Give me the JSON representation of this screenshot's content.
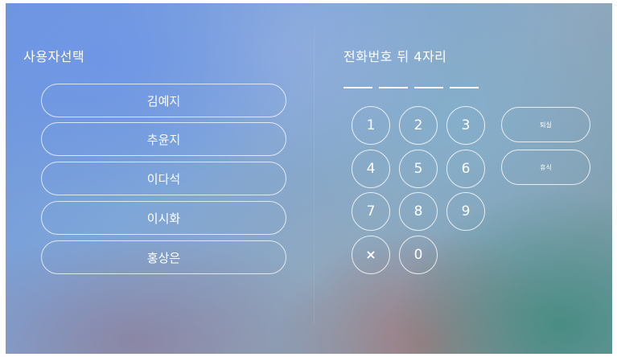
{
  "left_panel": {
    "heading": "사용자선택",
    "users": [
      "김예지",
      "추윤지",
      "이다석",
      "이시화",
      "홍상은"
    ]
  },
  "right_panel": {
    "heading": "전화번호 뒤 4자리",
    "keys": [
      "1",
      "2",
      "3",
      "4",
      "5",
      "6",
      "7",
      "8",
      "9",
      "0"
    ],
    "clear_icon": "×",
    "side_buttons": {
      "back": "퇴실",
      "rest": "휴식"
    }
  }
}
